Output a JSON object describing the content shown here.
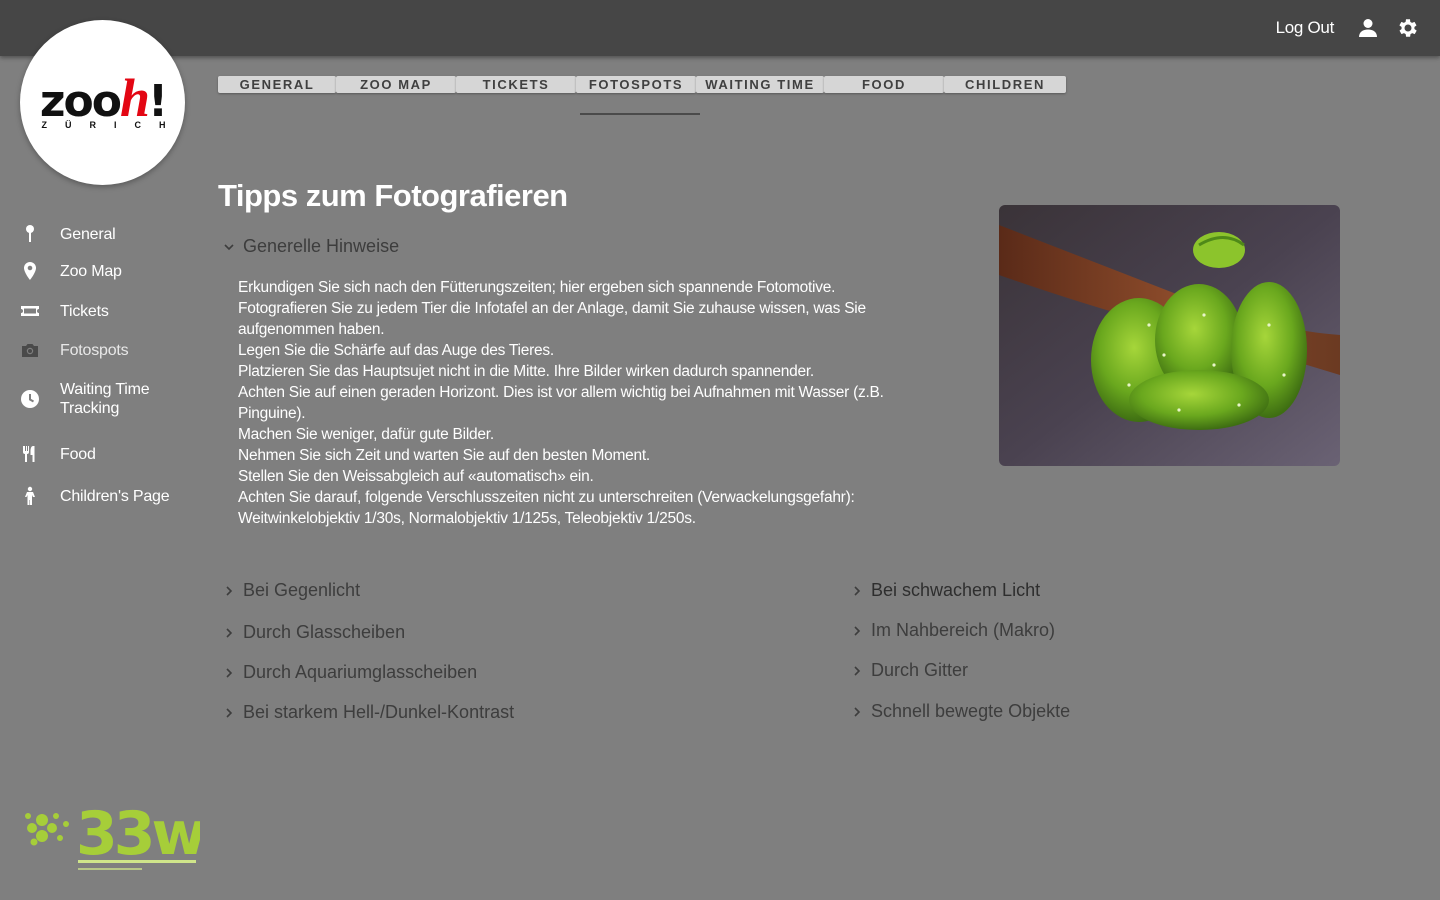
{
  "header": {
    "logout_label": "Log Out",
    "user_icon": "user-icon",
    "settings_icon": "gear-icon"
  },
  "logo": {
    "main_prefix": "zoo",
    "main_h": "h",
    "main_suffix": "!",
    "sub": "ZÜRICH"
  },
  "sidebar": {
    "items": [
      {
        "label": "General",
        "icon": "pin-icon"
      },
      {
        "label": "Zoo Map",
        "icon": "location-icon"
      },
      {
        "label": "Tickets",
        "icon": "ticket-icon"
      },
      {
        "label": "Fotospots",
        "icon": "camera-icon"
      },
      {
        "label": "Waiting Time Tracking",
        "icon": "clock-icon"
      },
      {
        "label": "Food",
        "icon": "cutlery-icon"
      },
      {
        "label": "Children's Page",
        "icon": "child-icon"
      }
    ]
  },
  "tabs": [
    {
      "label": "GENERAL"
    },
    {
      "label": "ZOO MAP"
    },
    {
      "label": "TICKETS"
    },
    {
      "label": "FOTOSPOTS",
      "active": true
    },
    {
      "label": "WAITING TIME"
    },
    {
      "label": "FOOD"
    },
    {
      "label": "CHILDREN"
    }
  ],
  "main": {
    "title": "Tipps zum Fotografieren",
    "open_section": "Generelle Hinweise",
    "tips": [
      "Erkundigen Sie sich nach den Fütterungszeiten; hier ergeben sich spannende Fotomotive.",
      "Fotografieren Sie zu jedem Tier die Infotafel an der Anlage, damit Sie zuhause wissen, was Sie aufgenommen haben.",
      "Legen Sie die Schärfe auf das Auge des Tieres.",
      "Platzieren Sie das Hauptsujet nicht in die Mitte. Ihre Bilder wirken dadurch spannender.",
      "Achten Sie auf einen geraden Horizont. Dies ist vor allem wichtig bei Aufnahmen mit Wasser (z.B. Pinguine).",
      "Machen Sie weniger, dafür gute Bilder.",
      "Nehmen Sie sich Zeit und warten Sie auf den besten Moment.",
      "Stellen Sie den Weissabgleich auf «automatisch» ein.",
      "Achten Sie darauf, folgende Verschlusszeiten nicht zu unterschreiten (Verwackelungsgefahr): Weitwinkelobjektiv 1/30s, Normalobjektiv 1/125s, Teleobjektiv 1/250s."
    ],
    "left_sections": [
      "Bei Gegenlicht",
      "Durch Glasscheiben",
      "Durch Aquariumglasscheiben",
      "Bei starkem Hell-/Dunkel-Kontrast"
    ],
    "right_sections": [
      "Bei schwachem Licht",
      "Im Nahbereich (Makro)",
      "Durch Gitter",
      "Schnell bewegte Objekte"
    ],
    "image_subject": "green-tree-python-photo"
  },
  "footer": {
    "logo_text": "33w"
  },
  "colors": {
    "background": "#7f7f7f",
    "topbar": "#464646",
    "tab": "#d6d6d6",
    "accent_green": "#a6ce39",
    "logo_red": "#e30613"
  }
}
